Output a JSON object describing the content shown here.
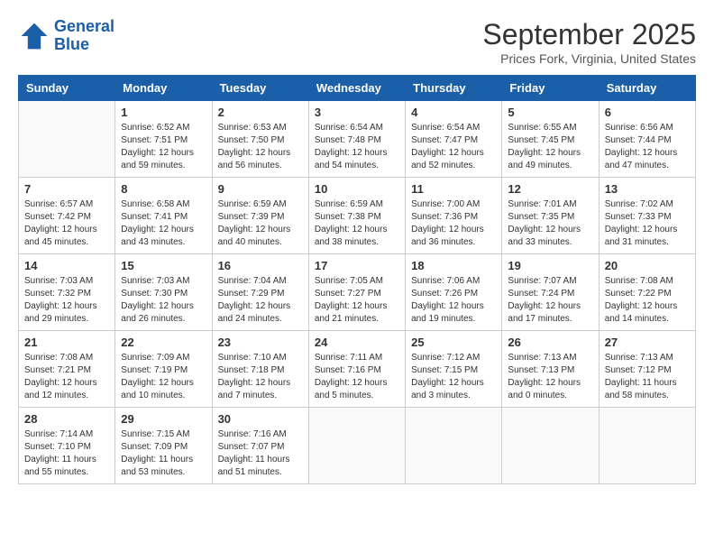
{
  "header": {
    "logo_line1": "General",
    "logo_line2": "Blue",
    "month": "September 2025",
    "location": "Prices Fork, Virginia, United States"
  },
  "days_of_week": [
    "Sunday",
    "Monday",
    "Tuesday",
    "Wednesday",
    "Thursday",
    "Friday",
    "Saturday"
  ],
  "weeks": [
    [
      {
        "day": "",
        "info": ""
      },
      {
        "day": "1",
        "info": "Sunrise: 6:52 AM\nSunset: 7:51 PM\nDaylight: 12 hours\nand 59 minutes."
      },
      {
        "day": "2",
        "info": "Sunrise: 6:53 AM\nSunset: 7:50 PM\nDaylight: 12 hours\nand 56 minutes."
      },
      {
        "day": "3",
        "info": "Sunrise: 6:54 AM\nSunset: 7:48 PM\nDaylight: 12 hours\nand 54 minutes."
      },
      {
        "day": "4",
        "info": "Sunrise: 6:54 AM\nSunset: 7:47 PM\nDaylight: 12 hours\nand 52 minutes."
      },
      {
        "day": "5",
        "info": "Sunrise: 6:55 AM\nSunset: 7:45 PM\nDaylight: 12 hours\nand 49 minutes."
      },
      {
        "day": "6",
        "info": "Sunrise: 6:56 AM\nSunset: 7:44 PM\nDaylight: 12 hours\nand 47 minutes."
      }
    ],
    [
      {
        "day": "7",
        "info": "Sunrise: 6:57 AM\nSunset: 7:42 PM\nDaylight: 12 hours\nand 45 minutes."
      },
      {
        "day": "8",
        "info": "Sunrise: 6:58 AM\nSunset: 7:41 PM\nDaylight: 12 hours\nand 43 minutes."
      },
      {
        "day": "9",
        "info": "Sunrise: 6:59 AM\nSunset: 7:39 PM\nDaylight: 12 hours\nand 40 minutes."
      },
      {
        "day": "10",
        "info": "Sunrise: 6:59 AM\nSunset: 7:38 PM\nDaylight: 12 hours\nand 38 minutes."
      },
      {
        "day": "11",
        "info": "Sunrise: 7:00 AM\nSunset: 7:36 PM\nDaylight: 12 hours\nand 36 minutes."
      },
      {
        "day": "12",
        "info": "Sunrise: 7:01 AM\nSunset: 7:35 PM\nDaylight: 12 hours\nand 33 minutes."
      },
      {
        "day": "13",
        "info": "Sunrise: 7:02 AM\nSunset: 7:33 PM\nDaylight: 12 hours\nand 31 minutes."
      }
    ],
    [
      {
        "day": "14",
        "info": "Sunrise: 7:03 AM\nSunset: 7:32 PM\nDaylight: 12 hours\nand 29 minutes."
      },
      {
        "day": "15",
        "info": "Sunrise: 7:03 AM\nSunset: 7:30 PM\nDaylight: 12 hours\nand 26 minutes."
      },
      {
        "day": "16",
        "info": "Sunrise: 7:04 AM\nSunset: 7:29 PM\nDaylight: 12 hours\nand 24 minutes."
      },
      {
        "day": "17",
        "info": "Sunrise: 7:05 AM\nSunset: 7:27 PM\nDaylight: 12 hours\nand 21 minutes."
      },
      {
        "day": "18",
        "info": "Sunrise: 7:06 AM\nSunset: 7:26 PM\nDaylight: 12 hours\nand 19 minutes."
      },
      {
        "day": "19",
        "info": "Sunrise: 7:07 AM\nSunset: 7:24 PM\nDaylight: 12 hours\nand 17 minutes."
      },
      {
        "day": "20",
        "info": "Sunrise: 7:08 AM\nSunset: 7:22 PM\nDaylight: 12 hours\nand 14 minutes."
      }
    ],
    [
      {
        "day": "21",
        "info": "Sunrise: 7:08 AM\nSunset: 7:21 PM\nDaylight: 12 hours\nand 12 minutes."
      },
      {
        "day": "22",
        "info": "Sunrise: 7:09 AM\nSunset: 7:19 PM\nDaylight: 12 hours\nand 10 minutes."
      },
      {
        "day": "23",
        "info": "Sunrise: 7:10 AM\nSunset: 7:18 PM\nDaylight: 12 hours\nand 7 minutes."
      },
      {
        "day": "24",
        "info": "Sunrise: 7:11 AM\nSunset: 7:16 PM\nDaylight: 12 hours\nand 5 minutes."
      },
      {
        "day": "25",
        "info": "Sunrise: 7:12 AM\nSunset: 7:15 PM\nDaylight: 12 hours\nand 3 minutes."
      },
      {
        "day": "26",
        "info": "Sunrise: 7:13 AM\nSunset: 7:13 PM\nDaylight: 12 hours\nand 0 minutes."
      },
      {
        "day": "27",
        "info": "Sunrise: 7:13 AM\nSunset: 7:12 PM\nDaylight: 11 hours\nand 58 minutes."
      }
    ],
    [
      {
        "day": "28",
        "info": "Sunrise: 7:14 AM\nSunset: 7:10 PM\nDaylight: 11 hours\nand 55 minutes."
      },
      {
        "day": "29",
        "info": "Sunrise: 7:15 AM\nSunset: 7:09 PM\nDaylight: 11 hours\nand 53 minutes."
      },
      {
        "day": "30",
        "info": "Sunrise: 7:16 AM\nSunset: 7:07 PM\nDaylight: 11 hours\nand 51 minutes."
      },
      {
        "day": "",
        "info": ""
      },
      {
        "day": "",
        "info": ""
      },
      {
        "day": "",
        "info": ""
      },
      {
        "day": "",
        "info": ""
      }
    ]
  ]
}
